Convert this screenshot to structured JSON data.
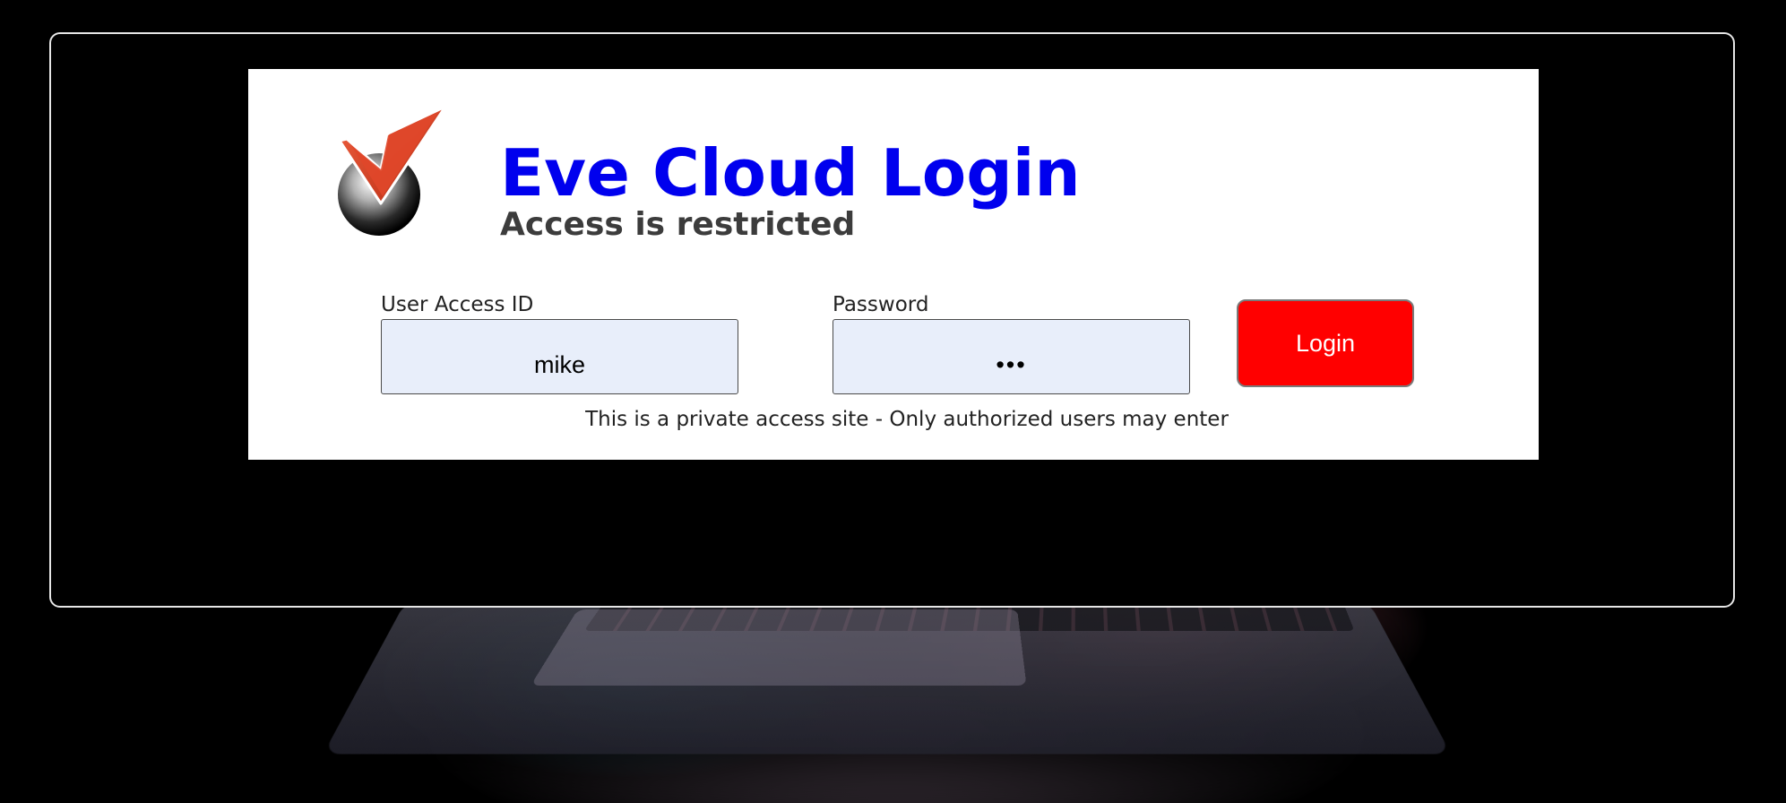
{
  "header": {
    "title": "Eve Cloud Login",
    "subtitle": "Access is restricted"
  },
  "logo": {
    "icon": "checkmark-sphere-icon",
    "check_color": "#d9401f",
    "sphere_color": "#2b2b2b"
  },
  "form": {
    "user_label": "User Access ID",
    "user_value": "mike",
    "password_label": "Password",
    "password_value": "•••",
    "login_label": "Login"
  },
  "notice": "This is a private access site - Only authorized users may enter",
  "colors": {
    "title": "#0000ee",
    "login_button": "#ff0000",
    "input_background": "#e8eefa",
    "frame_border": "#e6e6e6"
  }
}
